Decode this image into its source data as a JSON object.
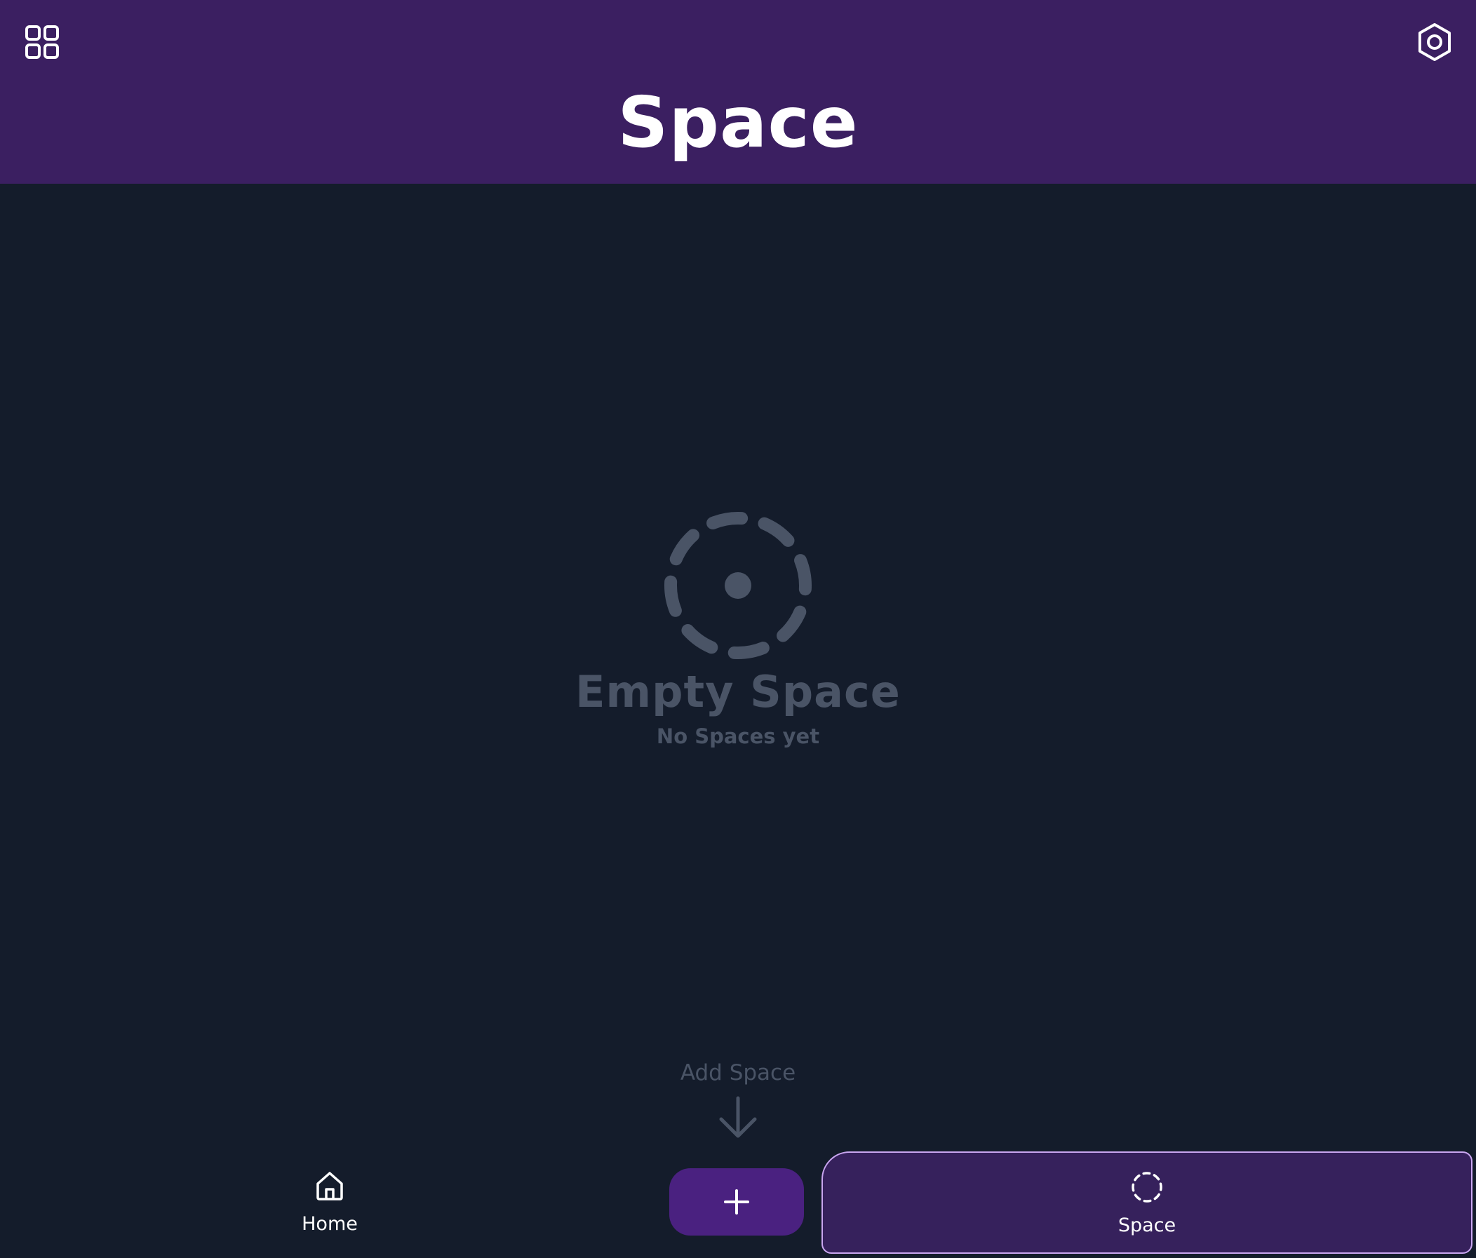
{
  "header": {
    "title": "Space",
    "menu_icon": "grid-icon",
    "settings_icon": "settings-hexagon-icon",
    "background_color": "#3b1f61"
  },
  "empty_state": {
    "icon": "dashed-circle-dot-icon",
    "title": "Empty Space",
    "subtitle": "No Spaces yet"
  },
  "add_hint": {
    "label": "Add Space",
    "icon": "arrow-down-icon"
  },
  "bottom_nav": {
    "items": [
      {
        "label": "Home",
        "icon": "home-icon",
        "active": false
      },
      {
        "label": "Space",
        "icon": "dashed-circle-icon",
        "active": true
      }
    ],
    "add_button_icon": "plus-icon",
    "add_button_color": "#4a2180"
  },
  "colors": {
    "background": "#141c2b",
    "muted_text": "#4a5466",
    "active_tab_bg": "#36215c",
    "active_tab_border": "#c9a6f0"
  }
}
